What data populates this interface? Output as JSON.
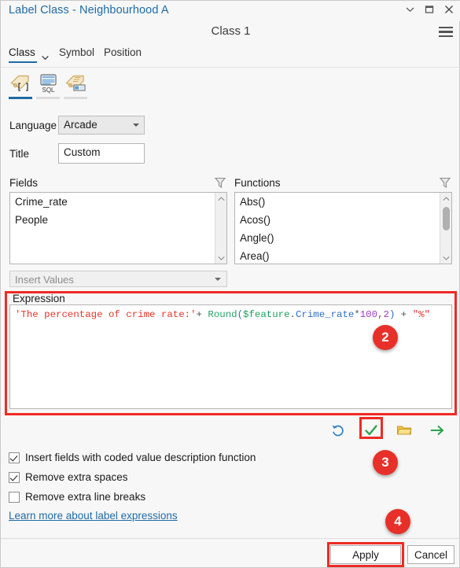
{
  "window": {
    "title": "Label Class - Neighbourhood A",
    "controls": [
      {
        "name": "chevron-down-icon",
        "label": "⌄"
      },
      {
        "name": "maximize-icon",
        "label": "□"
      },
      {
        "name": "close-icon",
        "label": "✕"
      }
    ],
    "accent_color": "#1f6aa5",
    "highlight_color": "#ef2a24"
  },
  "subheader": {
    "class_title": "Class 1",
    "menu_icon": "hamburger-menu-icon"
  },
  "tabs": [
    {
      "label": "Class",
      "active": true
    },
    {
      "label": "Symbol",
      "active": false
    },
    {
      "label": "Position",
      "active": false
    }
  ],
  "icon_strip": [
    {
      "name": "arcade-expression-icon",
      "active": true
    },
    {
      "name": "sql-query-icon",
      "active": false
    },
    {
      "name": "label-attribute-icon",
      "active": false
    }
  ],
  "form": {
    "language_label": "Language",
    "language_value": "Arcade",
    "title_label": "Title",
    "title_value": "Custom"
  },
  "fields_panel": {
    "label": "Fields",
    "filter_icon": "filter-funnel-icon",
    "items": [
      "Crime_rate",
      "People"
    ]
  },
  "functions_panel": {
    "label": "Functions",
    "filter_icon": "filter-funnel-icon",
    "items": [
      "Abs()",
      "Acos()",
      "Angle()",
      "Area()"
    ]
  },
  "insert_values": {
    "placeholder": "Insert Values"
  },
  "expression": {
    "group_label": "Expression",
    "full_text": "'The percentage of crime rate:'+ Round($feature.Crime_rate*100,2) + \"%\"",
    "tokens": [
      {
        "t": "'The percentage of crime rate:'",
        "c": "tok-str"
      },
      {
        "t": "+ ",
        "c": "tok-op"
      },
      {
        "t": "Round",
        "c": "tok-fn"
      },
      {
        "t": "(",
        "c": "tok-punc"
      },
      {
        "t": "$feature",
        "c": "tok-var"
      },
      {
        "t": ".",
        "c": "tok-op"
      },
      {
        "t": "Crime_rate",
        "c": "tok-fld"
      },
      {
        "t": "*",
        "c": "tok-op"
      },
      {
        "t": "100",
        "c": "tok-num"
      },
      {
        "t": ",",
        "c": "tok-op"
      },
      {
        "t": "2",
        "c": "tok-num"
      },
      {
        "t": ")",
        "c": "tok-punc"
      },
      {
        "t": " + ",
        "c": "tok-op"
      },
      {
        "t": "\"%\"",
        "c": "tok-str2"
      }
    ]
  },
  "actions": [
    {
      "name": "reset-undo-icon",
      "title": "Reset"
    },
    {
      "name": "verify-checkmark-icon",
      "title": "Verify",
      "highlighted": true
    },
    {
      "name": "open-folder-icon",
      "title": "Load"
    },
    {
      "name": "export-arrow-icon",
      "title": "Save"
    }
  ],
  "options": [
    {
      "label": "Insert fields with coded value description function",
      "checked": true
    },
    {
      "label": "Remove extra spaces",
      "checked": true
    },
    {
      "label": "Remove extra line breaks",
      "checked": false
    }
  ],
  "help_link": "Learn more about label expressions",
  "footer": {
    "apply_label": "Apply",
    "cancel_label": "Cancel"
  },
  "badges": [
    {
      "number": "2"
    },
    {
      "number": "3"
    },
    {
      "number": "4"
    }
  ]
}
